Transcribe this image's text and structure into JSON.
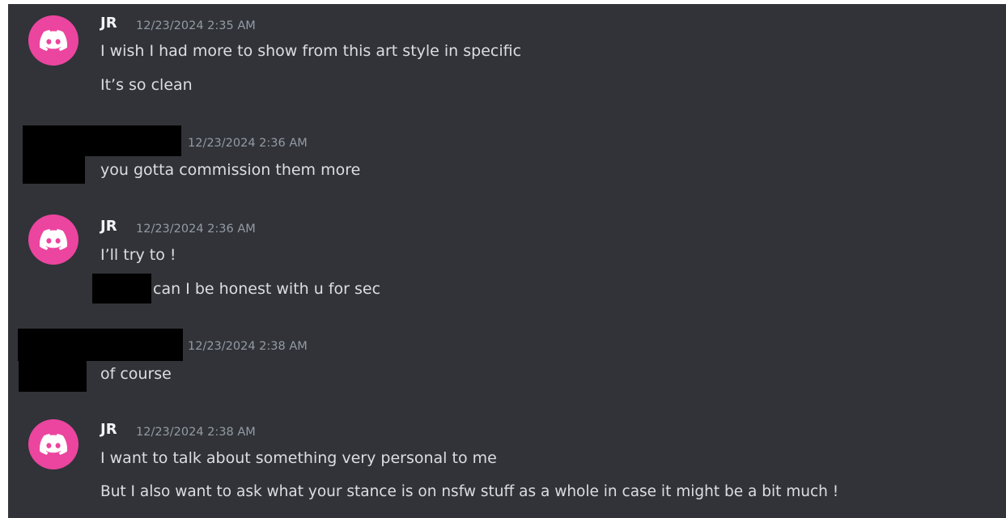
{
  "colors": {
    "background": "#313338",
    "avatar": "#eb459f",
    "author": "#f2f3f5",
    "timestamp": "#949ba4",
    "message": "#dbdee1",
    "redaction": "#000000"
  },
  "groups": [
    {
      "author": "JR",
      "timestamp": "12/23/2024 2:35 AM",
      "avatar_icon": "discord-logo-icon",
      "messages": [
        "I wish I had more to show from this art style in specific",
        "It’s so clean"
      ]
    },
    {
      "author_redacted": true,
      "timestamp": "12/23/2024 2:36 AM",
      "messages": [
        "you gotta commission them more"
      ]
    },
    {
      "author": "JR",
      "timestamp": "12/23/2024 2:36 AM",
      "avatar_icon": "discord-logo-icon",
      "messages": [
        "I’ll try to !",
        "can I be honest with u for sec"
      ]
    },
    {
      "author_redacted": true,
      "timestamp": "12/23/2024 2:38 AM",
      "messages": [
        "of course"
      ]
    },
    {
      "author": "JR",
      "timestamp": "12/23/2024 2:38 AM",
      "avatar_icon": "discord-logo-icon",
      "messages": [
        "I want to talk about something very personal to me",
        "But I also want to ask what your stance is on nsfw stuff as a whole in case it might be a bit much !"
      ]
    }
  ]
}
